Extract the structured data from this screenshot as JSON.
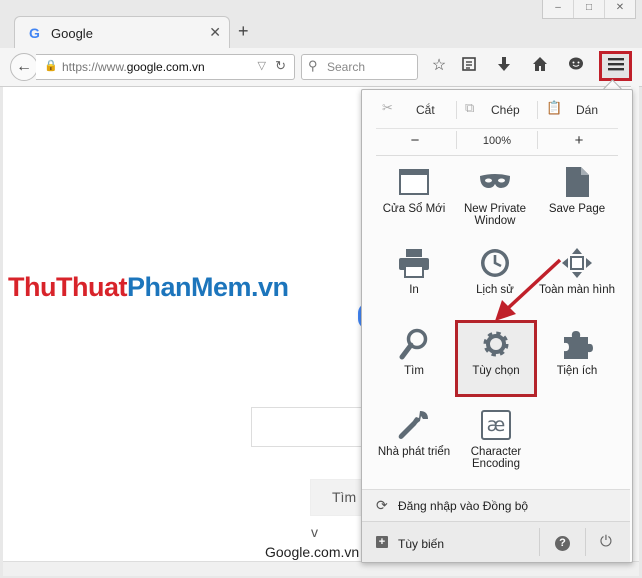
{
  "window": {
    "controls": [
      "‒",
      "□",
      "✕"
    ]
  },
  "tab": {
    "title": "Google",
    "favicon": "G",
    "close": "✕"
  },
  "new_tab": "+",
  "nav": {
    "back": "←",
    "url_prefix": "https://www.",
    "url_domain": "google.com.vn",
    "search_placeholder": "Search",
    "reload": "↻"
  },
  "toolbar_icons": [
    "star-icon",
    "reading-list-icon",
    "download-icon",
    "home-icon",
    "chat-icon"
  ],
  "menu_button_icon": "hamburger-icon",
  "page": {
    "brand_a": "ThuThuat",
    "brand_b": "PhanMem.vn",
    "search_button": "Tìm v",
    "footer": "Google.com.vn h"
  },
  "menu": {
    "edit": {
      "cut": "Cắt",
      "copy": "Chép",
      "paste": "Dán"
    },
    "zoom": {
      "minus": "−",
      "level": "100%",
      "plus": "+"
    },
    "items": [
      {
        "label": "Cửa Sổ Mới",
        "icon": "new-window-icon"
      },
      {
        "label": "New Private Window",
        "icon": "private-mask-icon"
      },
      {
        "label": "Save Page",
        "icon": "save-page-icon"
      },
      {
        "label": "In",
        "icon": "print-icon"
      },
      {
        "label": "Lịch sử",
        "icon": "history-clock-icon"
      },
      {
        "label": "Toàn màn hình",
        "icon": "fullscreen-icon"
      },
      {
        "label": "Tìm",
        "icon": "find-magnifier-icon"
      },
      {
        "label": "Tùy chọn",
        "icon": "options-gear-icon"
      },
      {
        "label": "Tiện ích",
        "icon": "addons-puzzle-icon"
      },
      {
        "label": "Nhà phát triển",
        "icon": "developer-wrench-icon"
      },
      {
        "label": "Character Encoding",
        "icon": "character-encoding-icon",
        "glyph": "æ"
      }
    ],
    "sync_label": "Đăng nhập vào Đồng bộ",
    "customize_label": "Tùy biến",
    "help": "?",
    "power": "⏻"
  },
  "colors": {
    "highlight": "#b4232a",
    "brand_red": "#d8232a",
    "brand_blue": "#1c75bc",
    "icon_gray": "#5f6b75"
  }
}
